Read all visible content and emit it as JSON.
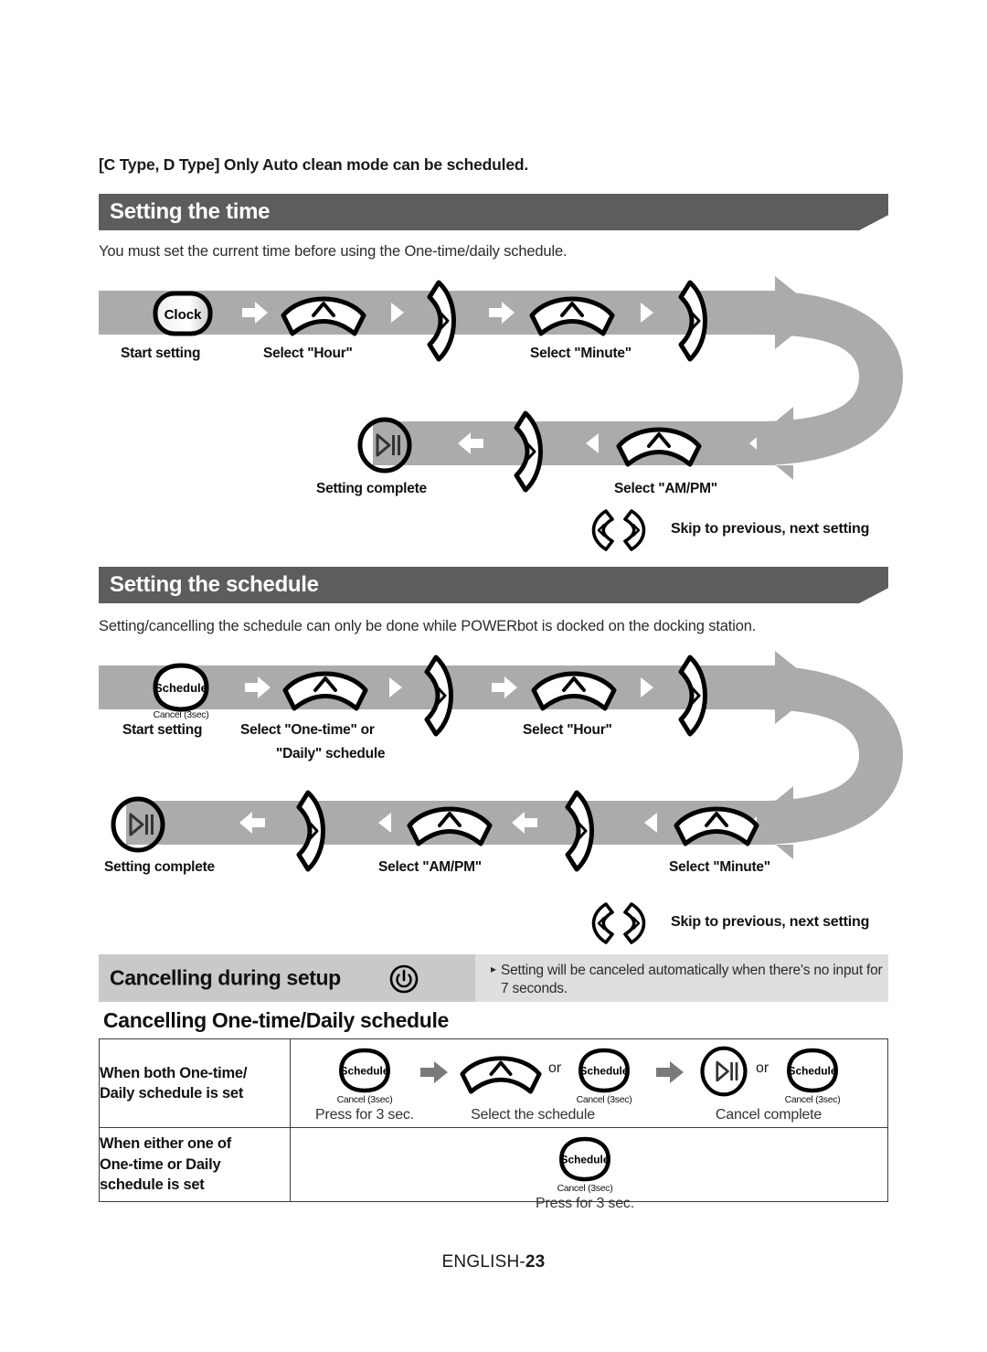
{
  "page": {
    "top_note": "[C Type, D Type] Only Auto clean mode can be scheduled.",
    "footer_label": "ENGLISH-",
    "footer_page": "23"
  },
  "sections": [
    {
      "id": "setting-the-time",
      "heading": "Setting the time",
      "intro": "You must set the current time before using the One-time/daily schedule.",
      "flow": {
        "row1": [
          {
            "icon": "clock-button",
            "label": "Start setting"
          },
          {
            "icon": "white-arrow",
            "label": ""
          },
          {
            "icon": "arc-up-button",
            "label": "Select \"Hour\""
          },
          {
            "icon": "small-triangle-right",
            "label": ""
          },
          {
            "icon": "next-curve-button",
            "label": ""
          },
          {
            "icon": "white-arrow",
            "label": ""
          },
          {
            "icon": "arc-up-button",
            "label": "Select \"Minute\""
          },
          {
            "icon": "small-triangle-right",
            "label": ""
          },
          {
            "icon": "next-curve-button",
            "label": ""
          }
        ],
        "row2": [
          {
            "icon": "play-pause-button",
            "label": "Setting complete"
          },
          {
            "icon": "white-arrow-left",
            "label": ""
          },
          {
            "icon": "next-curve-button",
            "label": ""
          },
          {
            "icon": "small-triangle-left",
            "label": ""
          },
          {
            "icon": "arc-up-button",
            "label": "Select \"AM/PM\""
          }
        ],
        "skip_note": "Skip to previous, next setting"
      }
    },
    {
      "id": "setting-the-schedule",
      "heading": "Setting the schedule",
      "intro": "Setting/cancelling the schedule can only be done while POWERbot is docked on the docking station.",
      "flow": {
        "row1": [
          {
            "icon": "schedule-button",
            "label": "Start setting",
            "sub": "Cancel (3sec)"
          },
          {
            "icon": "white-arrow",
            "label": ""
          },
          {
            "icon": "arc-up-button",
            "label": "Select \"One-time\" or\n\"Daily\" schedule"
          },
          {
            "icon": "small-triangle-right",
            "label": ""
          },
          {
            "icon": "next-curve-button",
            "label": ""
          },
          {
            "icon": "white-arrow",
            "label": ""
          },
          {
            "icon": "arc-up-button",
            "label": "Select \"Hour\""
          },
          {
            "icon": "small-triangle-right",
            "label": ""
          },
          {
            "icon": "next-curve-button",
            "label": ""
          }
        ],
        "row2": [
          {
            "icon": "play-pause-button",
            "label": "Setting complete"
          },
          {
            "icon": "white-arrow-left",
            "label": ""
          },
          {
            "icon": "next-curve-button",
            "label": ""
          },
          {
            "icon": "small-triangle-left",
            "label": ""
          },
          {
            "icon": "arc-up-button",
            "label": "Select \"AM/PM\""
          },
          {
            "icon": "white-arrow-left",
            "label": ""
          },
          {
            "icon": "next-curve-button",
            "label": ""
          },
          {
            "icon": "small-triangle-left",
            "label": ""
          },
          {
            "icon": "arc-up-button",
            "label": "Select \"Minute\""
          }
        ],
        "skip_note": "Skip to previous, next setting"
      }
    }
  ],
  "step_labels": {
    "start_setting": "Start setting",
    "select_hour": "Select \"Hour\"",
    "select_minute": "Select \"Minute\"",
    "select_ampm": "Select \"AM/PM\"",
    "setting_complete": "Setting complete",
    "select_one_time_l1": "Select \"One-time\" or",
    "select_one_time_l2": "\"Daily\" schedule",
    "skip_note": "Skip to previous, next setting"
  },
  "cancelling": {
    "title": "Cancelling during setup",
    "power_icon": "power-icon",
    "note": "Setting will be canceled automatically when there's no input for 7 seconds.",
    "sub_title": "Cancelling One-time/Daily schedule",
    "table": {
      "rows": [
        {
          "label_l1": "When both One-time/",
          "label_l2": "Daily schedule is set",
          "steps": [
            {
              "icon": "schedule-button",
              "sub": "Cancel (3sec)",
              "caption": "Press for 3 sec."
            },
            {
              "icon": "arc-up-button",
              "or": "or",
              "icon2": "schedule-button",
              "sub2": "Cancel (3sec)",
              "caption": "Select the schedule"
            },
            {
              "icon": "play-pause-button",
              "or": "or",
              "icon2": "schedule-button",
              "sub2": "Cancel (3sec)",
              "caption": "Cancel complete"
            }
          ]
        },
        {
          "label_l1": "When either one of",
          "label_l2": "One-time or Daily",
          "label_l3": "schedule is set",
          "steps": [
            {
              "icon": "schedule-button",
              "sub": "Cancel (3sec)",
              "caption": "Press for 3 sec."
            }
          ]
        }
      ]
    }
  },
  "button_text": {
    "clock": "Clock",
    "schedule": "Schedule",
    "cancel_3sec": "Cancel (3sec)",
    "or": "or"
  },
  "colors": {
    "heading_bar": "#5d5d5d",
    "flow_band": "#ababab",
    "cancel_band_label": "#c9c9c9",
    "cancel_band_note": "#dedede",
    "text": "#1a1a1a"
  }
}
